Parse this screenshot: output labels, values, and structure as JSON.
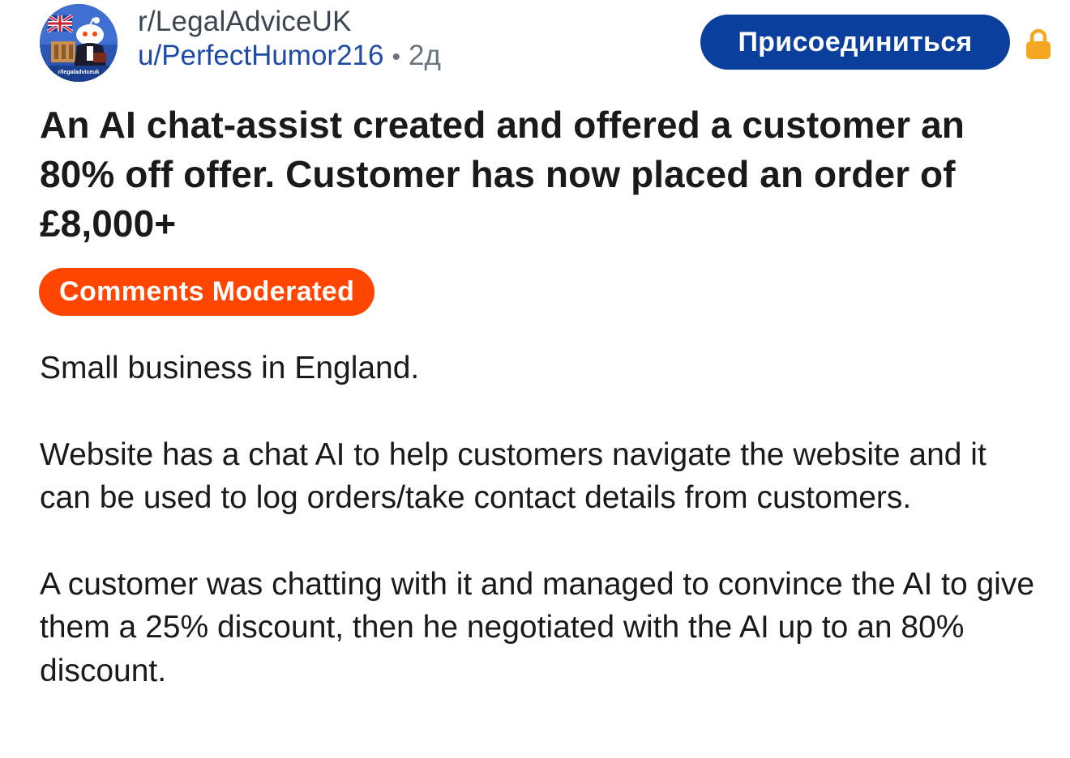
{
  "post": {
    "subreddit": "r/LegalAdviceUK",
    "author": "u/PerfectHumor216",
    "separator": "•",
    "age": "2д",
    "join_label": "Присоединиться",
    "title": "An AI chat-assist created and offered a customer an 80% off offer. Customer has now placed an order of £8,000+",
    "flair": "Comments Moderated",
    "paragraphs": [
      "Small business in England.",
      "Website has a chat AI to help customers navigate the website and it can be used to log orders/take contact details from customers.",
      "A customer was chatting with it and managed to convince the AI to give them a 25% discount, then he negotiated with the AI up to an 80% discount."
    ],
    "avatar_text": "r/legaladviceuk"
  },
  "icons": {
    "lock": "lock-icon",
    "avatar": "subreddit-avatar"
  },
  "colors": {
    "join_button": "#0a3f9e",
    "flair": "#ff4500",
    "username": "#1e4aa8",
    "lock": "#f5a623"
  }
}
